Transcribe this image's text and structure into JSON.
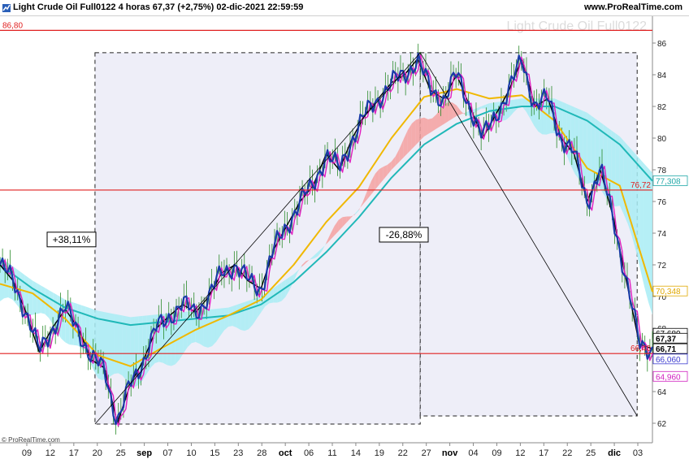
{
  "header": {
    "title": "Light Crude Oil Full0122 4 horas 67,37 (+2,75%) 02-dic-2021 22:59:59",
    "site": "www.ProRealTime.com"
  },
  "watermark": "Light Crude Oil Full0122",
  "copyright": "© ProRealTime.com",
  "colors": {
    "candles": "#1a3aa8",
    "fast_ma": "#e020c0",
    "mid_line": "#000000",
    "ma_yellow": "#f0b800",
    "ma_teal": "#20b8b8",
    "cloud_up": "#a8ecf4",
    "cloud_down": "#f4a0a0",
    "hline": "#e02020"
  },
  "chart_data": {
    "type": "line",
    "ylim": [
      61.5,
      87.5
    ],
    "y_ticks": [
      "62",
      "64",
      "66",
      "68",
      "70",
      "72",
      "74",
      "76",
      "78",
      "80",
      "82",
      "84",
      "86"
    ],
    "x_ticks": [
      {
        "label": "09",
        "bold": false
      },
      {
        "label": "12",
        "bold": false
      },
      {
        "label": "17",
        "bold": false
      },
      {
        "label": "20",
        "bold": false
      },
      {
        "label": "25",
        "bold": false
      },
      {
        "label": "sep",
        "bold": true
      },
      {
        "label": "07",
        "bold": false
      },
      {
        "label": "10",
        "bold": false
      },
      {
        "label": "15",
        "bold": false
      },
      {
        "label": "23",
        "bold": false
      },
      {
        "label": "28",
        "bold": false
      },
      {
        "label": "oct",
        "bold": true
      },
      {
        "label": "06",
        "bold": false
      },
      {
        "label": "11",
        "bold": false
      },
      {
        "label": "14",
        "bold": false
      },
      {
        "label": "19",
        "bold": false
      },
      {
        "label": "22",
        "bold": false
      },
      {
        "label": "27",
        "bold": false
      },
      {
        "label": "nov",
        "bold": true
      },
      {
        "label": "04",
        "bold": false
      },
      {
        "label": "09",
        "bold": false
      },
      {
        "label": "12",
        "bold": false
      },
      {
        "label": "17",
        "bold": false
      },
      {
        "label": "22",
        "bold": false
      },
      {
        "label": "25",
        "bold": false
      },
      {
        "label": "dic",
        "bold": true
      },
      {
        "label": "03",
        "bold": false
      }
    ],
    "horizontal_lines": [
      {
        "value": 86.8,
        "label": "86,80"
      },
      {
        "value": 76.72,
        "label": "76,72"
      },
      {
        "value": 66.4,
        "label": "66,40"
      }
    ],
    "price_labels": [
      {
        "text": "77,308",
        "value": 77.308,
        "color": "#20a8a8"
      },
      {
        "text": "70,348",
        "value": 70.348,
        "color": "#e0a800"
      },
      {
        "text": "67,680",
        "value": 67.68,
        "color": "#000000"
      },
      {
        "text": "67,37",
        "value": 67.37,
        "color": "#000000",
        "bold": true
      },
      {
        "text": "66,71",
        "value": 66.71,
        "color": "#000000",
        "bold": true
      },
      {
        "text": "66,060",
        "value": 66.06,
        "color": "#3a3ad0"
      },
      {
        "text": "64,960",
        "value": 64.96,
        "color": "#d020c0"
      }
    ],
    "annotations": [
      {
        "text": "+38,11%",
        "value": 73.6
      },
      {
        "text": "-26,88%",
        "value": 73.9
      }
    ],
    "measure_boxes": [
      {
        "x0": 0.1456,
        "x1": 0.6441,
        "y_low": 61.95,
        "y_high": 85.39
      },
      {
        "x0": 0.6441,
        "x1": 0.9766,
        "y_low": 62.46,
        "y_high": 85.39
      }
    ],
    "series": [
      {
        "name": "price",
        "x": [
          0,
          0.02,
          0.04,
          0.06,
          0.08,
          0.1,
          0.12,
          0.14,
          0.16,
          0.18,
          0.2,
          0.22,
          0.24,
          0.26,
          0.28,
          0.3,
          0.32,
          0.34,
          0.36,
          0.38,
          0.4,
          0.42,
          0.44,
          0.46,
          0.48,
          0.5,
          0.52,
          0.54,
          0.56,
          0.58,
          0.6,
          0.62,
          0.64,
          0.66,
          0.68,
          0.7,
          0.72,
          0.74,
          0.76,
          0.78,
          0.8,
          0.82,
          0.84,
          0.86,
          0.88,
          0.9,
          0.92,
          0.94,
          0.96,
          0.98,
          1
        ],
        "values": [
          72,
          71,
          69,
          66.5,
          68,
          69.2,
          68,
          66,
          65.5,
          62,
          64.5,
          66,
          68,
          68.8,
          69.5,
          69,
          70,
          71.5,
          72,
          71,
          70.5,
          73,
          74.5,
          76,
          77,
          79,
          78,
          80,
          81.5,
          82.5,
          83.5,
          84,
          85,
          83,
          82.5,
          84,
          82,
          80,
          81.5,
          83,
          85,
          82,
          82.5,
          80,
          79,
          76,
          78,
          75,
          71,
          67,
          66.7
        ]
      },
      {
        "name": "ma_teal",
        "x": [
          0,
          0.05,
          0.1,
          0.15,
          0.2,
          0.25,
          0.3,
          0.35,
          0.4,
          0.45,
          0.5,
          0.55,
          0.6,
          0.65,
          0.7,
          0.75,
          0.8,
          0.85,
          0.9,
          0.95,
          1
        ],
        "values": [
          72,
          70.5,
          69.3,
          68.6,
          68.2,
          68.4,
          68.6,
          68.8,
          69.5,
          70.9,
          72.8,
          75,
          77.5,
          79.6,
          80.9,
          81.7,
          82,
          82,
          81.1,
          79.6,
          77.3
        ]
      },
      {
        "name": "ma_yellow",
        "x": [
          0,
          0.05,
          0.1,
          0.15,
          0.2,
          0.25,
          0.3,
          0.35,
          0.4,
          0.45,
          0.5,
          0.55,
          0.6,
          0.65,
          0.7,
          0.75,
          0.8,
          0.85,
          0.9,
          0.95,
          1
        ],
        "values": [
          70.8,
          70.2,
          68.6,
          66.3,
          65.6,
          66.8,
          67.9,
          68.8,
          69.8,
          72,
          74.7,
          76.9,
          80,
          82.6,
          83.1,
          82.5,
          82.7,
          81.1,
          78.1,
          77,
          70.3
        ]
      }
    ]
  }
}
